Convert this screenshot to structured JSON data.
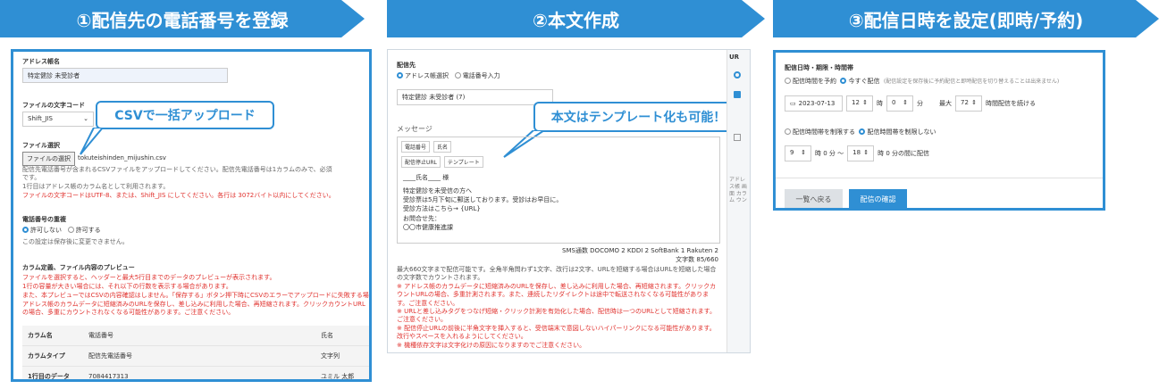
{
  "steps": [
    {
      "label": "①配信先の電話番号を登録"
    },
    {
      "label": "②本文作成"
    },
    {
      "label": "③配信日時を設定(即時/予約)"
    }
  ],
  "panel1": {
    "address_label": "アドレス帳名",
    "address_value": "特定健診 未受診者",
    "charset_label": "ファイルの文字コード",
    "charset_value": "Shift_JIS",
    "callout": "CSVで一括アップロード",
    "file_label": "ファイル選択",
    "file_button": "ファイルの選択",
    "file_name": "tokuteishinden_mijushin.csv",
    "help1": "配信先電話番号が含まれるCSVファイルをアップロードしてください。配信先電話番号は1カラムのみで、必須です。",
    "help2": "1行目はアドレス帳のカラム名として利用されます。",
    "help_red": "ファイルの文字コードはUTF-8、または、Shift_JIS にしてください。各行は 3072バイト以内にしてください。",
    "dup_label": "電話番号の重複",
    "dup_opt1": "許可しない",
    "dup_opt2": "許可する",
    "dup_note": "この設定は保存後に変更できません。",
    "preview_label": "カラム定義、ファイル内容のプレビュー",
    "preview_red1": "ファイルを選択すると、ヘッダーと最大5行目までのデータのプレビューが表示されます。",
    "preview_red2": "1行の容量が大きい場合には、それ以下の行数を表示する場合があります。",
    "preview_red3": "また、本プレビューではCSVの内容確認はしません。「保存する」ボタン押下時にCSVのエラーでアップロードに失敗する場合があります。",
    "preview_red4": "アドレス帳のカラムデータに短縮済みのURLを保存し、差し込みに利用した場合、再短縮されます。クリックカウントURLの場合、多重にカウントされなくなる可能性があります。ご注意ください。",
    "table": [
      {
        "a": "カラム名",
        "b": "電話番号",
        "c": "氏名"
      },
      {
        "a": "カラムタイプ",
        "b": "配信先電話番号",
        "c": "文字列"
      },
      {
        "a": "1行目のデータ",
        "b": "7084417313",
        "c": "ユミル 太郎"
      }
    ]
  },
  "panel2": {
    "dest_label": "配信先",
    "opt_addr": "アドレス帳選択",
    "opt_phone": "電話番号入力",
    "dest_value": "特定健診 未受診者 (7)",
    "msg_label": "メッセージ",
    "callout": "本文はテンプレート化も可能！",
    "tb1": "電話番号",
    "tb2": "氏名",
    "tb3": "配信停止URL",
    "tb4": "テンプレート",
    "body1": "____氏名____ 様",
    "body2": "特定健診を未受信の方へ",
    "body3": "受診票は5月下旬に郵送しております。受診はお早目に。",
    "body4": "受診方法はこちら→ {URL}",
    "body5": "お問合せ先：",
    "body6": "〇〇市健康推進課",
    "sms_count": "SMS通数 DOCOMO 2 KDDI 2 SoftBank 1 Rakuten 2",
    "char_count": "文字数 85/660",
    "note1": "最大660文字まで配信可能です。全角半角問わず1文字、改行は2文字、URLを短縮する場合はURLを短縮した場合の文字数でカウントされます。",
    "note2": "※ アドレス帳のカラムデータに短縮済みのURLを保存し、差し込みに利用した場合、再短縮されます。クリックカウントURLの場合、多重計測されます。また、連続したリダイレクトは途中で転送されなくなる可能性があります。ご注意ください。",
    "note3": "※ URLと差し込みタグをつなげ短縮・クリック計測を有効化した場合、配信時は一つのURLとして短縮されます。ご注意ください。",
    "note4": "※ 配信停止URLの前後に半角文字を挿入すると、受信端末で意図しないハイパーリンクになる可能性があります。改行やスペースを入れるようにしてください。",
    "note5": "※ 機種依存文字は文字化けの原因になりますのでご注意ください。",
    "side_ur": "UR",
    "side_text": "アドレス帳 画面 カラム ウン"
  },
  "panel3": {
    "section_label": "配信日時・期限・時間帯",
    "opt_reserve": "配信時間を予約",
    "opt_now": "今すぐ配信",
    "opt_note": "(配信設定を保存後に予約配信と即時配信を切り替えることは出来ません)",
    "date": "2023-07-13",
    "hour": "12",
    "hour_unit": "時",
    "minute": "0",
    "minute_unit": "分",
    "max_label": "最大",
    "max_value": "72",
    "max_suffix": "時間配信を続ける",
    "opt_limit": "配信時間帯を制限する",
    "opt_nolimit": "配信時間帯を制限しない",
    "from_h": "9",
    "from_text": "時 0 分 ～",
    "to_h": "18",
    "to_text": "時 0 分の間に配信",
    "back_button": "一覧へ戻る",
    "confirm_button": "配信の確認"
  }
}
